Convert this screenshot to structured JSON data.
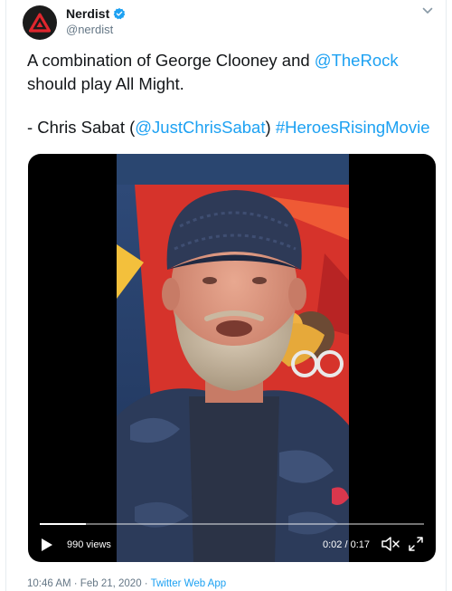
{
  "account": {
    "display_name": "Nerdist",
    "handle": "@nerdist",
    "avatar_icon": "nerdist-triangle-logo-icon",
    "verified_icon": "verified-badge-icon",
    "brand_color": "#1b1b1b",
    "logo_color": "#e0262d"
  },
  "tweet": {
    "line1_prefix": "A combination of George Clooney and ",
    "mention_rock": "@TheRock",
    "line2": "should play All Might.",
    "attrib_prefix": "- Chris Sabat (",
    "mention_sabat": "@JustChrisSabat",
    "attrib_close": ")",
    "hashtag": "#HeroesRisingMovie",
    "link_color": "#1da1f2"
  },
  "video": {
    "views": "990 views",
    "time": "0:02 / 0:17",
    "progress": 0.12,
    "play_icon": "play-icon",
    "mute_icon": "mute-icon",
    "fullscreen_icon": "fullscreen-icon"
  },
  "meta": {
    "timestamp": "10:46 AM · Feb 21, 2020",
    "separator": " · ",
    "source": "Twitter Web App"
  }
}
